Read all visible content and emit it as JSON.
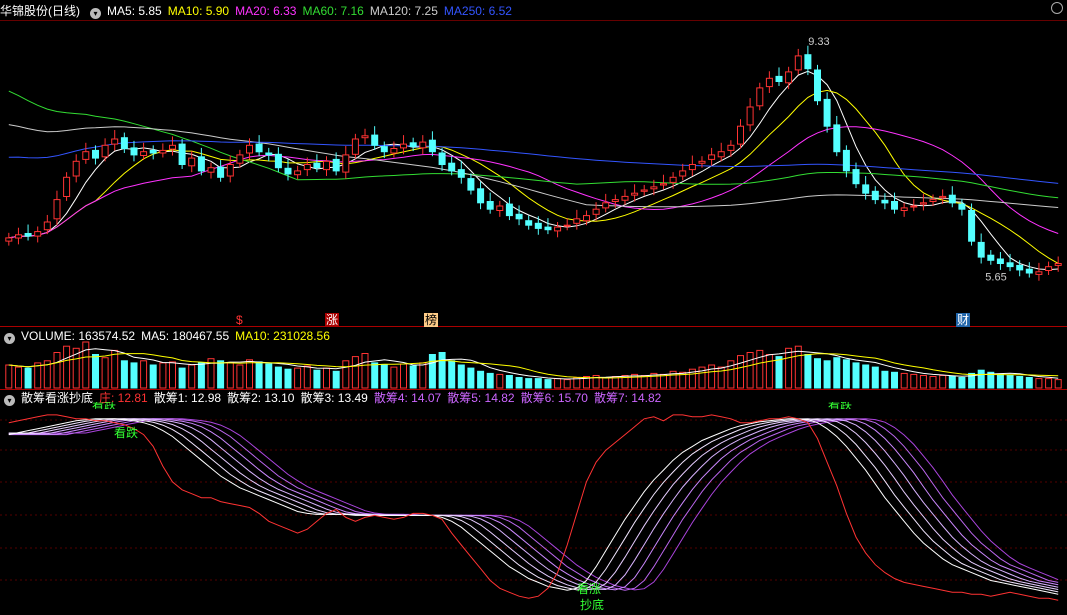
{
  "stock": {
    "name": "华锦股份",
    "period": "(日线)"
  },
  "ma_legend": [
    {
      "label": "MA5: 5.85",
      "color": "#ffffff"
    },
    {
      "label": "MA10: 5.90",
      "color": "#ffff00"
    },
    {
      "label": "MA20: 6.33",
      "color": "#ff33ff"
    },
    {
      "label": "MA60: 7.16",
      "color": "#33dd33"
    },
    {
      "label": "MA120: 7.25",
      "color": "#cccccc"
    },
    {
      "label": "MA250: 6.52",
      "color": "#3355ff"
    }
  ],
  "volume_legend": [
    {
      "label": "VOLUME: 163574.52",
      "color": "#ffffff"
    },
    {
      "label": "MA5: 180467.55",
      "color": "#ffffff"
    },
    {
      "label": "MA10: 231028.56",
      "color": "#ffff00"
    }
  ],
  "indicator_legend": {
    "name": "散筹看涨抄底",
    "items": [
      {
        "label": "庄: 12.81",
        "color": "#ff3333"
      },
      {
        "label": "散筹1: 12.98",
        "color": "#ffffff"
      },
      {
        "label": "散筹2: 13.10",
        "color": "#ffffff"
      },
      {
        "label": "散筹3: 13.49",
        "color": "#ffffff"
      },
      {
        "label": "散筹4: 14.07",
        "color": "#cc66ff"
      },
      {
        "label": "散筹5: 14.82",
        "color": "#cc66ff"
      },
      {
        "label": "散筹6: 15.70",
        "color": "#cc66ff"
      },
      {
        "label": "散筹7: 14.82",
        "color": "#cc66ff"
      }
    ]
  },
  "event_tags": [
    {
      "text": "$",
      "color": "#ff3333"
    },
    {
      "text": "涨",
      "color": "#ffffff"
    },
    {
      "text": "榜",
      "color": "#ffcc88"
    },
    {
      "text": "财",
      "color": "#88ccff"
    }
  ],
  "signal_labels": {
    "top_left": "看跌",
    "top_left_cut": "看跌",
    "top_right_cut": "看跌",
    "bottom_up": "看涨",
    "bottom_buy": "抄底"
  },
  "chart_data": {
    "type": "candlestick",
    "title": "华锦股份 (日线)",
    "price_annotations": {
      "high": 9.33,
      "low": 5.65
    },
    "ylim": [
      5.2,
      9.6
    ],
    "closes": [
      6.25,
      6.3,
      6.28,
      6.35,
      6.5,
      6.85,
      7.2,
      7.45,
      7.6,
      7.5,
      7.7,
      7.8,
      7.65,
      7.55,
      7.6,
      7.58,
      7.62,
      7.7,
      7.4,
      7.5,
      7.3,
      7.35,
      7.2,
      7.4,
      7.55,
      7.7,
      7.6,
      7.55,
      7.35,
      7.25,
      7.3,
      7.4,
      7.35,
      7.45,
      7.3,
      7.55,
      7.8,
      7.85,
      7.7,
      7.6,
      7.65,
      7.72,
      7.68,
      7.75,
      7.6,
      7.4,
      7.3,
      7.2,
      7.0,
      6.8,
      6.7,
      6.75,
      6.6,
      6.55,
      6.45,
      6.4,
      6.38,
      6.42,
      6.45,
      6.55,
      6.6,
      6.7,
      6.8,
      6.85,
      6.9,
      6.95,
      7.0,
      7.05,
      7.1,
      7.2,
      7.3,
      7.4,
      7.45,
      7.55,
      7.6,
      7.7,
      8.0,
      8.3,
      8.6,
      8.75,
      8.7,
      8.85,
      9.1,
      8.9,
      8.4,
      8.0,
      7.6,
      7.3,
      7.1,
      6.95,
      6.85,
      6.8,
      6.7,
      6.72,
      6.75,
      6.8,
      6.85,
      6.9,
      6.8,
      6.7,
      6.2,
      5.95,
      5.9,
      5.85,
      5.8,
      5.75,
      5.7,
      5.72,
      5.8,
      5.85
    ],
    "opens": [
      6.2,
      6.25,
      6.32,
      6.28,
      6.38,
      6.55,
      6.9,
      7.22,
      7.48,
      7.62,
      7.52,
      7.72,
      7.82,
      7.66,
      7.54,
      7.62,
      7.58,
      7.64,
      7.72,
      7.38,
      7.52,
      7.28,
      7.36,
      7.22,
      7.42,
      7.58,
      7.72,
      7.58,
      7.56,
      7.34,
      7.24,
      7.32,
      7.42,
      7.32,
      7.48,
      7.28,
      7.56,
      7.82,
      7.86,
      7.68,
      7.58,
      7.66,
      7.74,
      7.66,
      7.78,
      7.58,
      7.42,
      7.32,
      7.18,
      7.02,
      6.82,
      6.68,
      6.78,
      6.62,
      6.52,
      6.48,
      6.42,
      6.36,
      6.44,
      6.48,
      6.52,
      6.62,
      6.72,
      6.82,
      6.84,
      6.92,
      6.98,
      7.02,
      7.08,
      7.12,
      7.22,
      7.32,
      7.42,
      7.48,
      7.52,
      7.62,
      7.72,
      8.02,
      8.32,
      8.62,
      8.78,
      8.68,
      8.88,
      9.12,
      8.88,
      8.42,
      8.02,
      7.62,
      7.32,
      7.08,
      6.98,
      6.84,
      6.82,
      6.68,
      6.74,
      6.78,
      6.82,
      6.88,
      6.92,
      6.78,
      6.68,
      6.18,
      5.98,
      5.92,
      5.86,
      5.82,
      5.76,
      5.68,
      5.74,
      5.82
    ],
    "series": [
      {
        "name": "MA5",
        "color": "#ffffff"
      },
      {
        "name": "MA10",
        "color": "#ffff00"
      },
      {
        "name": "MA20",
        "color": "#ff33ff"
      },
      {
        "name": "MA60",
        "color": "#33dd33"
      },
      {
        "name": "MA120",
        "color": "#cccccc"
      },
      {
        "name": "MA250",
        "color": "#3355ff"
      }
    ],
    "volume": [
      2.2,
      2.0,
      1.9,
      2.4,
      2.6,
      3.4,
      4.0,
      3.8,
      4.4,
      3.2,
      2.9,
      3.6,
      2.6,
      2.4,
      2.6,
      2.2,
      2.4,
      2.5,
      1.9,
      2.2,
      2.4,
      2.8,
      2.6,
      2.4,
      2.2,
      2.7,
      2.5,
      2.3,
      2.0,
      1.8,
      1.9,
      2.1,
      1.7,
      1.9,
      1.6,
      2.6,
      3.0,
      3.3,
      2.4,
      2.2,
      2.0,
      2.3,
      2.1,
      2.4,
      3.2,
      3.4,
      2.6,
      2.2,
      1.9,
      1.6,
      1.4,
      1.3,
      1.2,
      1.0,
      0.9,
      0.9,
      0.8,
      0.9,
      0.8,
      1.0,
      1.1,
      1.2,
      1.0,
      1.1,
      1.2,
      1.3,
      1.2,
      1.4,
      1.3,
      1.6,
      1.5,
      1.8,
      2.0,
      2.2,
      2.0,
      2.6,
      3.1,
      3.4,
      3.6,
      3.2,
      3.0,
      3.8,
      4.0,
      3.2,
      2.8,
      2.6,
      2.9,
      2.7,
      2.4,
      2.2,
      2.0,
      1.6,
      1.5,
      1.4,
      1.3,
      1.2,
      1.1,
      1.2,
      1.1,
      1.0,
      1.4,
      1.7,
      1.5,
      1.3,
      1.2,
      1.1,
      1.0,
      0.9,
      0.9,
      0.8
    ],
    "indicator": {
      "zhuang": [
        9.6,
        9.7,
        9.8,
        9.9,
        10.0,
        10.0,
        9.9,
        9.8,
        9.8,
        9.7,
        9.7,
        9.6,
        9.5,
        9.3,
        9.0,
        8.4,
        7.4,
        6.6,
        6.2,
        6.0,
        5.8,
        5.8,
        5.6,
        5.5,
        5.4,
        5.3,
        5.0,
        4.6,
        4.4,
        4.2,
        4.0,
        4.2,
        4.6,
        5.0,
        5.2,
        4.8,
        4.6,
        4.8,
        4.9,
        4.8,
        4.7,
        4.8,
        5.0,
        5.0,
        4.9,
        4.7,
        4.0,
        3.4,
        2.8,
        2.2,
        1.6,
        1.2,
        1.0,
        0.8,
        0.7,
        0.8,
        1.2,
        2.0,
        3.4,
        5.0,
        6.6,
        7.6,
        8.2,
        8.6,
        9.0,
        9.4,
        9.8,
        9.9,
        9.7,
        10.0,
        10.0,
        9.9,
        9.9,
        10.0,
        9.9,
        9.8,
        9.6,
        9.6,
        9.7,
        9.8,
        9.8,
        9.9,
        9.8,
        9.6,
        8.8,
        7.6,
        6.4,
        5.0,
        3.8,
        3.0,
        2.4,
        2.0,
        1.7,
        1.5,
        1.4,
        1.3,
        1.2,
        1.1,
        1.0,
        1.0,
        0.9,
        0.9,
        0.8,
        0.9,
        1.0,
        0.9,
        0.8,
        0.7,
        0.7,
        0.6
      ],
      "sanchou_base": [
        9.0,
        9.1,
        9.2,
        9.3,
        9.4,
        9.5,
        9.6,
        9.7,
        9.75,
        9.8,
        9.8,
        9.8,
        9.75,
        9.7,
        9.6,
        9.45,
        9.2,
        8.9,
        8.5,
        8.1,
        7.7,
        7.3,
        6.9,
        6.6,
        6.3,
        6.1,
        5.9,
        5.7,
        5.5,
        5.3,
        5.1,
        5.0,
        4.95,
        4.95,
        4.95,
        4.95,
        4.9,
        4.9,
        4.9,
        4.9,
        4.9,
        4.9,
        4.9,
        4.9,
        4.9,
        4.8,
        4.6,
        4.3,
        3.9,
        3.5,
        3.1,
        2.7,
        2.3,
        2.0,
        1.7,
        1.5,
        1.3,
        1.2,
        1.1,
        1.2,
        1.6,
        2.3,
        3.1,
        3.9,
        4.7,
        5.4,
        6.1,
        6.7,
        7.2,
        7.7,
        8.1,
        8.4,
        8.7,
        8.9,
        9.1,
        9.3,
        9.45,
        9.55,
        9.65,
        9.7,
        9.75,
        9.8,
        9.8,
        9.75,
        9.6,
        9.3,
        8.9,
        8.4,
        7.8,
        7.2,
        6.5,
        5.8,
        5.2,
        4.6,
        4.0,
        3.5,
        3.1,
        2.7,
        2.4,
        2.2,
        2.0,
        1.8,
        1.6,
        1.5,
        1.4,
        1.3,
        1.2,
        1.1,
        1.0,
        0.9
      ]
    }
  }
}
